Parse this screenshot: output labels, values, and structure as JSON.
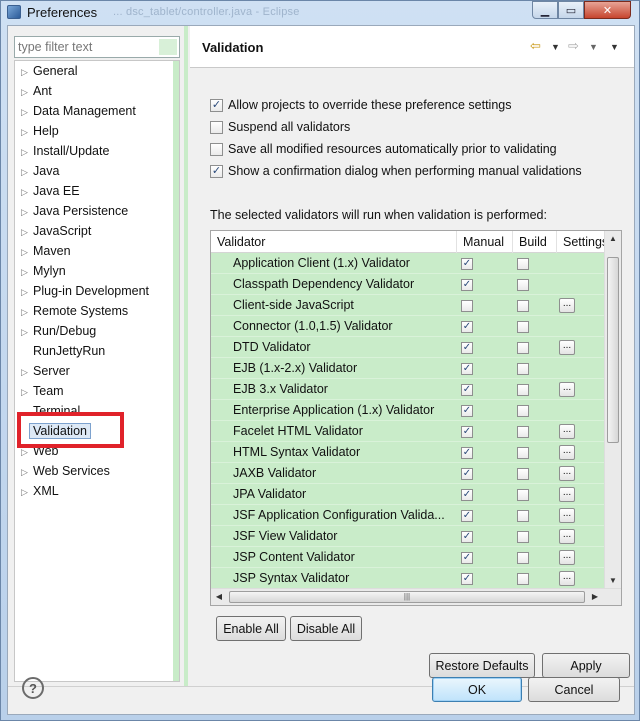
{
  "window": {
    "title": "Preferences",
    "ghost_title": "... dsc_tablet/controller.java - Eclipse"
  },
  "filter": {
    "placeholder": "type filter text"
  },
  "tree": {
    "items": [
      {
        "label": "General",
        "arrow": true
      },
      {
        "label": "Ant",
        "arrow": true
      },
      {
        "label": "Data Management",
        "arrow": true
      },
      {
        "label": "Help",
        "arrow": true
      },
      {
        "label": "Install/Update",
        "arrow": true
      },
      {
        "label": "Java",
        "arrow": true
      },
      {
        "label": "Java EE",
        "arrow": true
      },
      {
        "label": "Java Persistence",
        "arrow": true
      },
      {
        "label": "JavaScript",
        "arrow": true
      },
      {
        "label": "Maven",
        "arrow": true
      },
      {
        "label": "Mylyn",
        "arrow": true
      },
      {
        "label": "Plug-in Development",
        "arrow": true
      },
      {
        "label": "Remote Systems",
        "arrow": true
      },
      {
        "label": "Run/Debug",
        "arrow": true
      },
      {
        "label": "RunJettyRun",
        "arrow": false
      },
      {
        "label": "Server",
        "arrow": true
      },
      {
        "label": "Team",
        "arrow": true
      },
      {
        "label": "Terminal",
        "arrow": false
      },
      {
        "label": "Validation",
        "arrow": false,
        "selected": true
      },
      {
        "label": "Web",
        "arrow": true
      },
      {
        "label": "Web Services",
        "arrow": true
      },
      {
        "label": "XML",
        "arrow": true
      }
    ]
  },
  "page": {
    "title": "Validation",
    "options": [
      {
        "label": "Allow projects to override these preference settings",
        "checked": true
      },
      {
        "label": "Suspend all validators",
        "checked": false
      },
      {
        "label": "Save all modified resources automatically prior to validating",
        "checked": false
      },
      {
        "label": "Show a confirmation dialog when performing manual validations",
        "checked": true
      }
    ],
    "info": "The selected validators will run when validation is performed:"
  },
  "table": {
    "headers": [
      "Validator",
      "Manual",
      "Build",
      "Settings"
    ],
    "rows": [
      {
        "name": "Application Client (1.x) Validator",
        "manual": true,
        "build": false,
        "settings": false
      },
      {
        "name": "Classpath Dependency Validator",
        "manual": true,
        "build": false,
        "settings": false
      },
      {
        "name": "Client-side JavaScript",
        "manual": false,
        "build": false,
        "settings": true
      },
      {
        "name": "Connector (1.0,1.5) Validator",
        "manual": true,
        "build": false,
        "settings": false
      },
      {
        "name": "DTD Validator",
        "manual": true,
        "build": false,
        "settings": true
      },
      {
        "name": "EJB (1.x-2.x) Validator",
        "manual": true,
        "build": false,
        "settings": false
      },
      {
        "name": "EJB 3.x Validator",
        "manual": true,
        "build": false,
        "settings": true
      },
      {
        "name": "Enterprise Application (1.x) Validator",
        "manual": true,
        "build": false,
        "settings": false
      },
      {
        "name": "Facelet HTML Validator",
        "manual": true,
        "build": false,
        "settings": true
      },
      {
        "name": "HTML Syntax Validator",
        "manual": true,
        "build": false,
        "settings": true
      },
      {
        "name": "JAXB Validator",
        "manual": true,
        "build": false,
        "settings": true
      },
      {
        "name": "JPA Validator",
        "manual": true,
        "build": false,
        "settings": true
      },
      {
        "name": "JSF Application Configuration Valida...",
        "manual": true,
        "build": false,
        "settings": true
      },
      {
        "name": "JSF View Validator",
        "manual": true,
        "build": false,
        "settings": true
      },
      {
        "name": "JSP Content Validator",
        "manual": true,
        "build": false,
        "settings": true
      },
      {
        "name": "JSP Syntax Validator",
        "manual": true,
        "build": false,
        "settings": true
      }
    ]
  },
  "buttons": {
    "enable_all": "Enable All",
    "disable_all": "Disable All",
    "restore_defaults": "Restore Defaults",
    "apply": "Apply",
    "ok": "OK",
    "cancel": "Cancel"
  },
  "icons": {
    "settings_glyph": "..."
  }
}
